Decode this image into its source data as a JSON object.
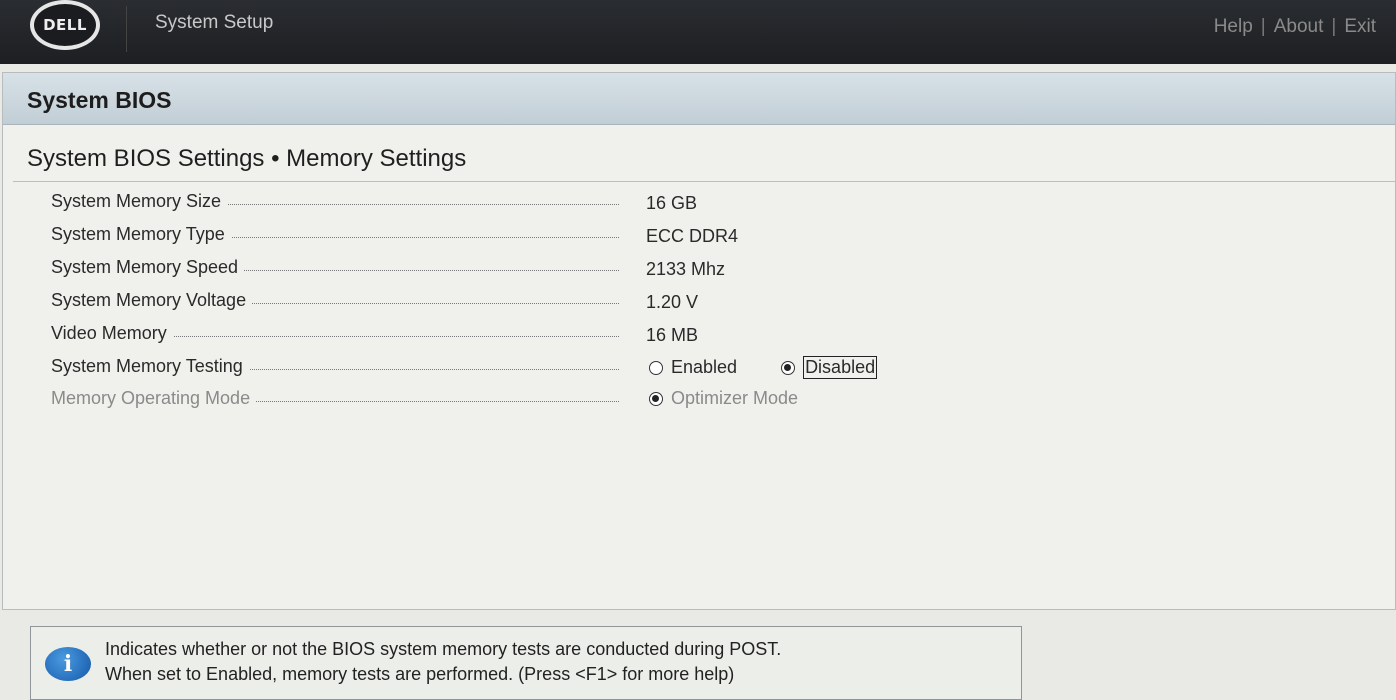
{
  "header": {
    "logo_text": "DELL",
    "app_title": "System Setup",
    "links": [
      "Help",
      "About",
      "Exit"
    ],
    "separator": "|"
  },
  "panel": {
    "title": "System BIOS",
    "section_title": "System BIOS Settings • Memory Settings"
  },
  "settings": [
    {
      "label": "System Memory Size",
      "value": "16 GB"
    },
    {
      "label": "System Memory Type",
      "value": "ECC DDR4"
    },
    {
      "label": "System Memory Speed",
      "value": "2133 Mhz"
    },
    {
      "label": "System Memory Voltage",
      "value": "1.20 V"
    },
    {
      "label": "Video Memory",
      "value": "16 MB"
    },
    {
      "label": "System Memory Testing",
      "options": [
        "Enabled",
        "Disabled"
      ],
      "selected": "Disabled",
      "focused": "Disabled"
    },
    {
      "label": "Memory Operating Mode",
      "options": [
        "Optimizer Mode"
      ],
      "selected": "Optimizer Mode",
      "disabled": true
    }
  ],
  "help": {
    "icon": "info-icon",
    "line1": "Indicates whether or not the BIOS system memory tests are conducted during POST.",
    "line2": "When set to Enabled, memory tests are performed. (Press <F1> for more help)"
  },
  "colors": {
    "header_bg": "#1d1f22",
    "panel_header_bg": "#c2ced6",
    "info_blue": "#1458a8"
  }
}
